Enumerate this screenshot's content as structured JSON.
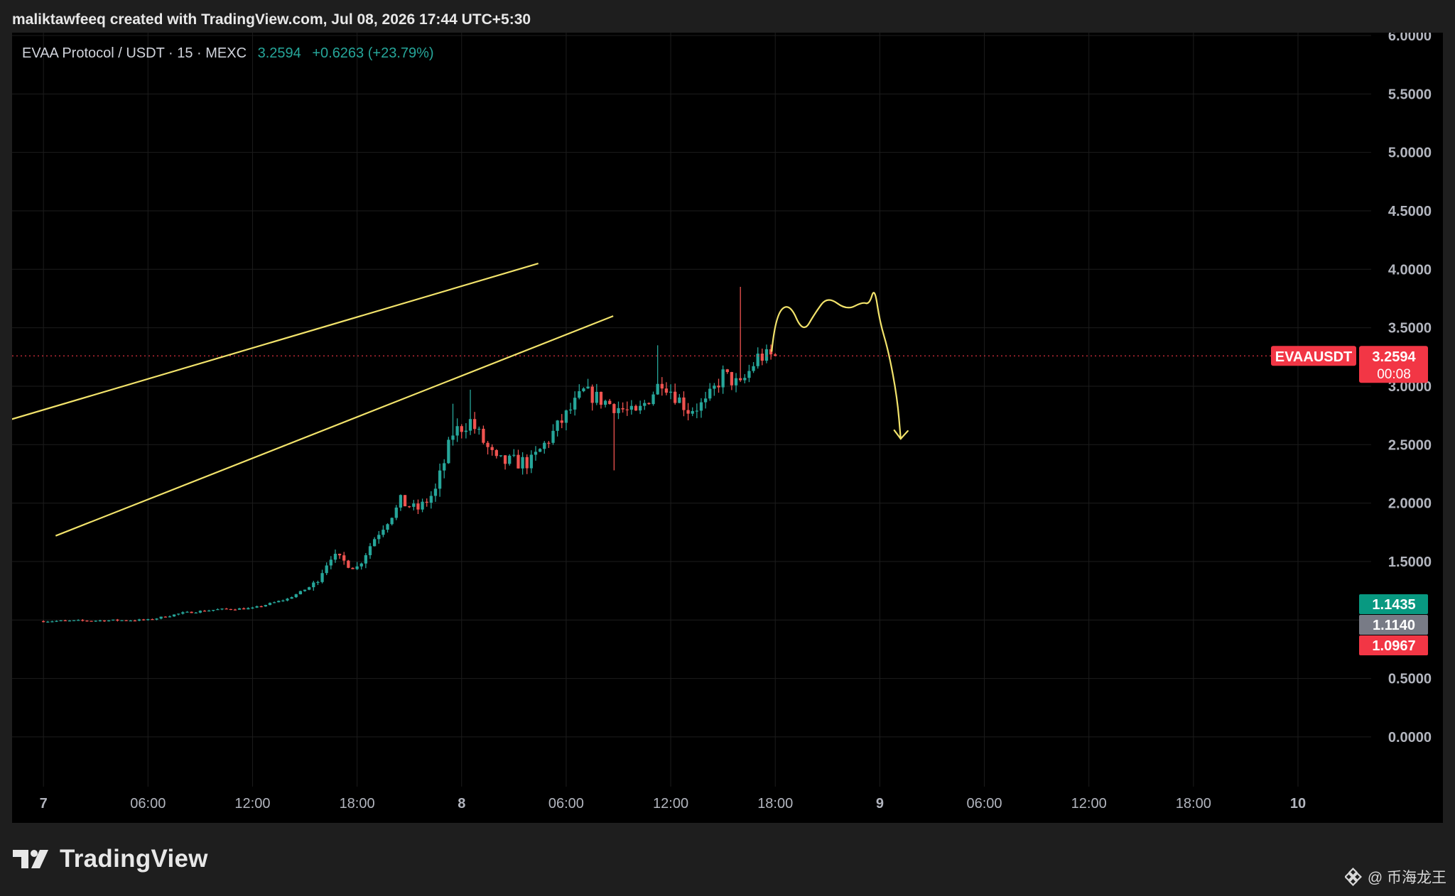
{
  "header": {
    "caption": "maliktawfeeq created with TradingView.com, Jul 08, 2026 17:44 UTC+5:30"
  },
  "legend": {
    "symbol": "EVAA Protocol / USDT · 15 · MEXC",
    "price": "3.2594",
    "change": "+0.6263 (+23.79%)"
  },
  "branding": {
    "logo_icon": "tradingview-logo-icon",
    "name": "TradingView"
  },
  "watermark": {
    "icon": "binance-square-icon",
    "text": "@ 币海龙王"
  },
  "colors": {
    "background": "#000000",
    "up": "#26a69a",
    "down": "#ef5350",
    "drawing": "#f2e36b",
    "grid": "#1c1c1c",
    "axis_text": "#b2b5be"
  },
  "chart_data": {
    "type": "candlestick",
    "timeframe": "15",
    "exchange": "MEXC",
    "y_scale": {
      "min": -0.45,
      "max": 6.0
    },
    "y_ticks": [
      {
        "value": 6.0,
        "label": "6.0000"
      },
      {
        "value": 5.5,
        "label": "5.5000"
      },
      {
        "value": 5.0,
        "label": "5.0000"
      },
      {
        "value": 4.5,
        "label": "4.5000"
      },
      {
        "value": 4.0,
        "label": "4.0000"
      },
      {
        "value": 3.5,
        "label": "3.5000"
      },
      {
        "value": 3.0,
        "label": "3.0000"
      },
      {
        "value": 2.5,
        "label": "2.5000"
      },
      {
        "value": 2.0,
        "label": "2.0000"
      },
      {
        "value": 1.5,
        "label": "1.5000"
      },
      {
        "value": 0.5,
        "label": "0.5000"
      },
      {
        "value": 0.0,
        "label": "0.0000"
      }
    ],
    "x_ticks": [
      {
        "hours": 0,
        "label": "7"
      },
      {
        "hours": 6,
        "label": "06:00"
      },
      {
        "hours": 12,
        "label": "12:00"
      },
      {
        "hours": 18,
        "label": "18:00"
      },
      {
        "hours": 24,
        "label": "8"
      },
      {
        "hours": 30,
        "label": "06:00"
      },
      {
        "hours": 36,
        "label": "12:00"
      },
      {
        "hours": 42,
        "label": "18:00"
      },
      {
        "hours": 48,
        "label": "9"
      },
      {
        "hours": 54,
        "label": "06:00"
      },
      {
        "hours": 60,
        "label": "12:00"
      },
      {
        "hours": 66,
        "label": "18:00"
      },
      {
        "hours": 72,
        "label": "10"
      }
    ],
    "x_range_hours": [
      -1.8,
      76.2
    ],
    "price_labels": [
      {
        "name": "last-price",
        "value": 3.2594,
        "text": "3.2594",
        "subtext": "00:08",
        "color": "#f23645"
      },
      {
        "name": "high",
        "value": 1.1435,
        "text": "1.1435",
        "color": "#089981"
      },
      {
        "name": "mid",
        "value": 1.114,
        "text": "1.1140",
        "color": "#787b86"
      },
      {
        "name": "low",
        "value": 1.0967,
        "text": "1.0967",
        "color": "#f23645"
      }
    ],
    "symbol_tag": "EVAAUSDT",
    "key_points": [
      {
        "hours": 0,
        "price": 0.99
      },
      {
        "hours": 6,
        "price": 1.0
      },
      {
        "hours": 8,
        "price": 1.06
      },
      {
        "hours": 10,
        "price": 1.09
      },
      {
        "hours": 12,
        "price": 1.1
      },
      {
        "hours": 14,
        "price": 1.18
      },
      {
        "hours": 15.5,
        "price": 1.3
      },
      {
        "hours": 16.5,
        "price": 1.55
      },
      {
        "hours": 18,
        "price": 1.45
      },
      {
        "hours": 19,
        "price": 1.7
      },
      {
        "hours": 20.5,
        "price": 2.0
      },
      {
        "hours": 21.5,
        "price": 1.95
      },
      {
        "hours": 22.5,
        "price": 2.1
      },
      {
        "hours": 23.5,
        "price": 2.6
      },
      {
        "hours": 24.5,
        "price": 2.7
      },
      {
        "hours": 26,
        "price": 2.35
      },
      {
        "hours": 28,
        "price": 2.35
      },
      {
        "hours": 29.5,
        "price": 2.65
      },
      {
        "hours": 31,
        "price": 2.95
      },
      {
        "hours": 32.5,
        "price": 2.85
      },
      {
        "hours": 34,
        "price": 2.75
      },
      {
        "hours": 35.5,
        "price": 3.05
      },
      {
        "hours": 37,
        "price": 2.8
      },
      {
        "hours": 38,
        "price": 2.85
      },
      {
        "hours": 39,
        "price": 3.1
      },
      {
        "hours": 40,
        "price": 3.0
      },
      {
        "hours": 41,
        "price": 3.25
      },
      {
        "hours": 42,
        "price": 3.26
      }
    ],
    "wick_spikes": [
      {
        "hours": 40.0,
        "high": 3.85
      },
      {
        "hours": 35.3,
        "high": 3.35
      },
      {
        "hours": 32.8,
        "low": 2.28
      },
      {
        "hours": 24.5,
        "high": 2.97
      },
      {
        "hours": 23.6,
        "high": 2.85
      }
    ],
    "drawings": {
      "channel_upper": [
        [
          -6.3,
          2.52
        ],
        [
          28.4,
          4.05
        ]
      ],
      "channel_lower": [
        [
          0.7,
          1.72
        ],
        [
          32.7,
          3.6
        ]
      ],
      "path": [
        [
          41.8,
          3.3
        ],
        [
          42.0,
          3.6
        ],
        [
          42.8,
          3.72
        ],
        [
          43.6,
          3.45
        ],
        [
          44.3,
          3.63
        ],
        [
          45.0,
          3.77
        ],
        [
          46.1,
          3.65
        ],
        [
          47.0,
          3.72
        ],
        [
          47.4,
          3.7
        ],
        [
          47.7,
          3.85
        ],
        [
          48.0,
          3.55
        ],
        [
          48.5,
          3.3
        ],
        [
          49.0,
          2.9
        ],
        [
          49.2,
          2.55
        ]
      ],
      "arrow_tip": [
        49.2,
        2.55
      ]
    }
  }
}
